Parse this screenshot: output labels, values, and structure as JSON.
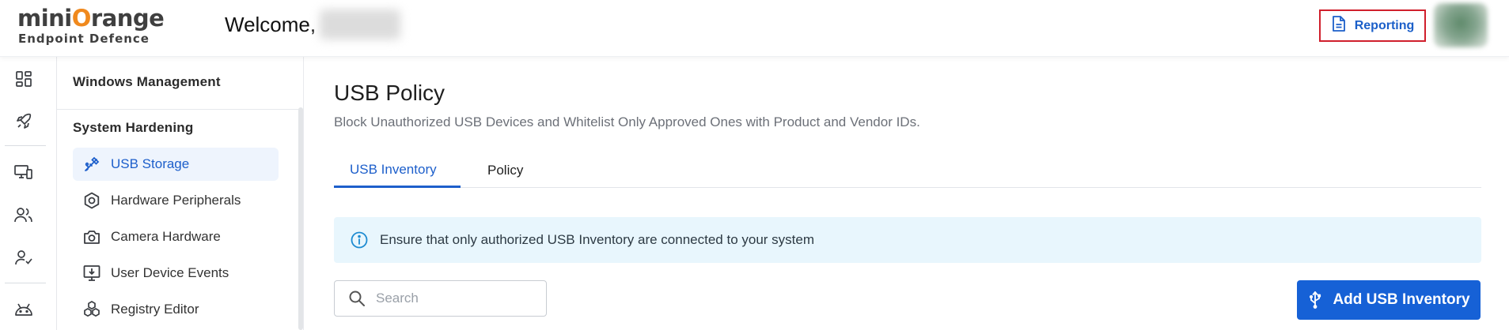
{
  "brand": {
    "logo_part1": "mini",
    "logo_o": "O",
    "logo_part2": "range",
    "logo_tagline": "Endpoint Defence"
  },
  "header": {
    "welcome": "Welcome,",
    "reporting_label": "Reporting",
    "accent_color": "#1b5fc9",
    "highlight_border_color": "#d01f2c"
  },
  "rail": {
    "icons": [
      "dashboard-icon",
      "rocket-icon",
      "devices-icon",
      "users-icon",
      "user-check-icon",
      "android-icon"
    ]
  },
  "subnav": {
    "section_windows": "Windows Management",
    "section_hardening": "System Hardening",
    "items": [
      {
        "label": "USB Storage",
        "icon": "usb-icon",
        "active": true
      },
      {
        "label": "Hardware Peripherals",
        "icon": "hexagon-icon",
        "active": false
      },
      {
        "label": "Camera Hardware",
        "icon": "camera-icon",
        "active": false
      },
      {
        "label": "User Device Events",
        "icon": "monitor-download-icon",
        "active": false
      },
      {
        "label": "Registry Editor",
        "icon": "registry-icon",
        "active": false
      }
    ]
  },
  "main": {
    "title": "USB Policy",
    "subtitle": "Block Unauthorized USB Devices and Whitelist Only Approved Ones with Product and Vendor IDs.",
    "tabs": [
      {
        "label": "USB Inventory",
        "active": true
      },
      {
        "label": "Policy",
        "active": false
      }
    ],
    "info_text": "Ensure that only authorized USB Inventory are connected to your system",
    "search": {
      "placeholder": "Search",
      "value": ""
    },
    "add_button_label": "Add USB Inventory",
    "primary_color": "#1661d6",
    "info_bg_color": "#e8f6fd"
  }
}
